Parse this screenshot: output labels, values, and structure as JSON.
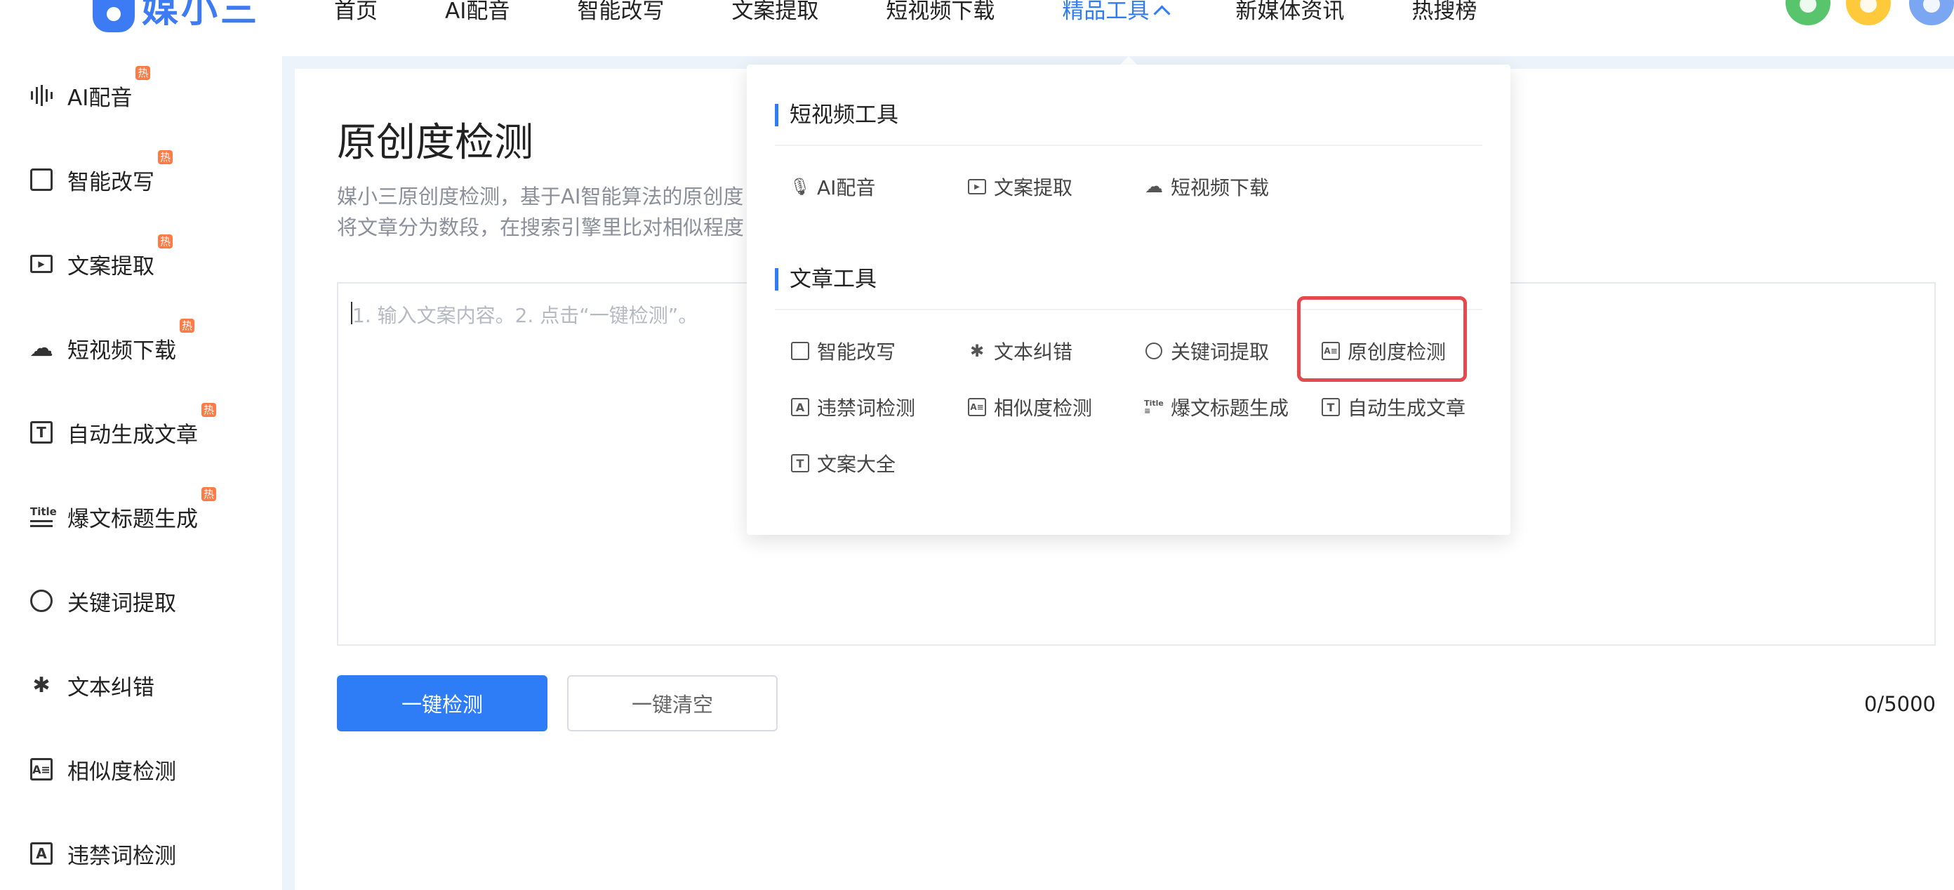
{
  "app": {
    "logo_text": "媒小三"
  },
  "nav": {
    "items": [
      "首页",
      "AI配音",
      "智能改写",
      "文案提取",
      "短视频下载",
      "精品工具",
      "新媒体资讯",
      "热搜榜"
    ],
    "active_index": 5
  },
  "sidebar": {
    "hot_badge": "热",
    "items": [
      {
        "label": "AI配音",
        "icon": "waveform-icon",
        "hot": true
      },
      {
        "label": "智能改写",
        "icon": "edit-icon",
        "hot": true
      },
      {
        "label": "文案提取",
        "icon": "video-icon",
        "hot": true
      },
      {
        "label": "短视频下载",
        "icon": "cloud-download-icon",
        "hot": true
      },
      {
        "label": "自动生成文章",
        "icon": "text-box-icon",
        "hot": true
      },
      {
        "label": "爆文标题生成",
        "icon": "title-icon",
        "hot": true
      },
      {
        "label": "关键词提取",
        "icon": "target-icon",
        "hot": false
      },
      {
        "label": "文本纠错",
        "icon": "bug-icon",
        "hot": false
      },
      {
        "label": "相似度检测",
        "icon": "image-text-icon",
        "hot": false
      },
      {
        "label": "违禁词检测",
        "icon": "letter-a-icon",
        "hot": false
      }
    ]
  },
  "main": {
    "title": "原创度检测",
    "desc_line1": "媒小三原创度检测，基于AI智能算法的原创度",
    "desc_line2": "将文章分为数段，在搜索引擎里比对相似程度",
    "editor_placeholder": "1. 输入文案内容。2. 点击“一键检测”。",
    "detect_button": "一键检测",
    "clear_button": "一键清空",
    "counter": "0/5000"
  },
  "dropdown": {
    "section1_title": "短视频工具",
    "section1_items": [
      {
        "label": "AI配音",
        "icon": "microphone-icon"
      },
      {
        "label": "文案提取",
        "icon": "video-icon"
      },
      {
        "label": "短视频下载",
        "icon": "cloud-download-icon"
      }
    ],
    "section2_title": "文章工具",
    "section2_items": [
      {
        "label": "智能改写",
        "icon": "edit-icon"
      },
      {
        "label": "文本纠错",
        "icon": "bug-icon"
      },
      {
        "label": "关键词提取",
        "icon": "target-icon"
      },
      {
        "label": "原创度检测",
        "icon": "image-text-icon",
        "highlighted": true
      },
      {
        "label": "违禁词检测",
        "icon": "letter-a-icon"
      },
      {
        "label": "相似度检测",
        "icon": "image-text-icon"
      },
      {
        "label": "爆文标题生成",
        "icon": "title-icon"
      },
      {
        "label": "自动生成文章",
        "icon": "text-box-icon"
      },
      {
        "label": "文案大全",
        "icon": "text-box-icon"
      }
    ]
  },
  "colors": {
    "accent": "#2f7df6",
    "hot_badge": "#ff7a45",
    "highlight": "#e5484d",
    "page_bg": "#edf3fb"
  }
}
